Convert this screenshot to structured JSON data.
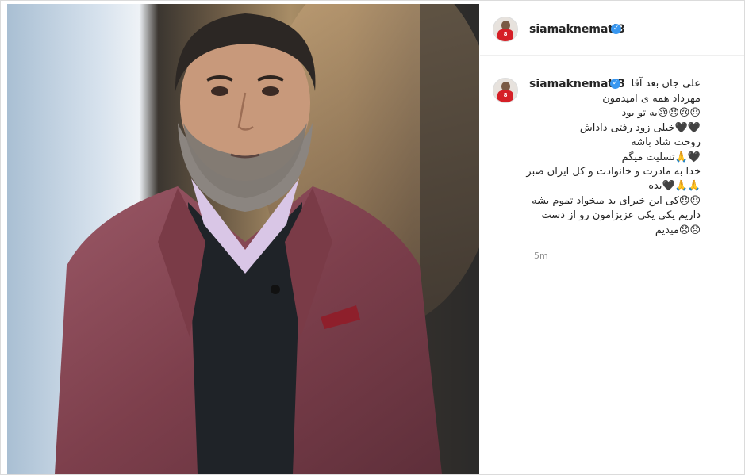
{
  "post": {
    "username": "siamaknemati8",
    "avatar_number": "8",
    "caption_first": "علی جان بعد آقا",
    "caption_lines": [
      "مهرداد همه ی امیدمون",
      "😞😢😞😢به تو بود",
      "🖤🖤خیلی زود رفتی داداش",
      "روحت شاد باشه",
      "🖤🙏تسلیت میگم",
      "خدا به مادرت و خانوادت و کل ایران صبر",
      "🙏🙏🖤بده",
      "😞😞کی این خبرای بد میخواد تموم بشه",
      "داریم یکی یکی عزیزامون رو از دست",
      "😞😞میدیم"
    ],
    "time": "5m"
  },
  "colors": {
    "verified": "#3897f0",
    "jacket": "#8c4a55",
    "border": "#dbdbdb"
  },
  "icons": [
    "verified-badge-icon"
  ]
}
